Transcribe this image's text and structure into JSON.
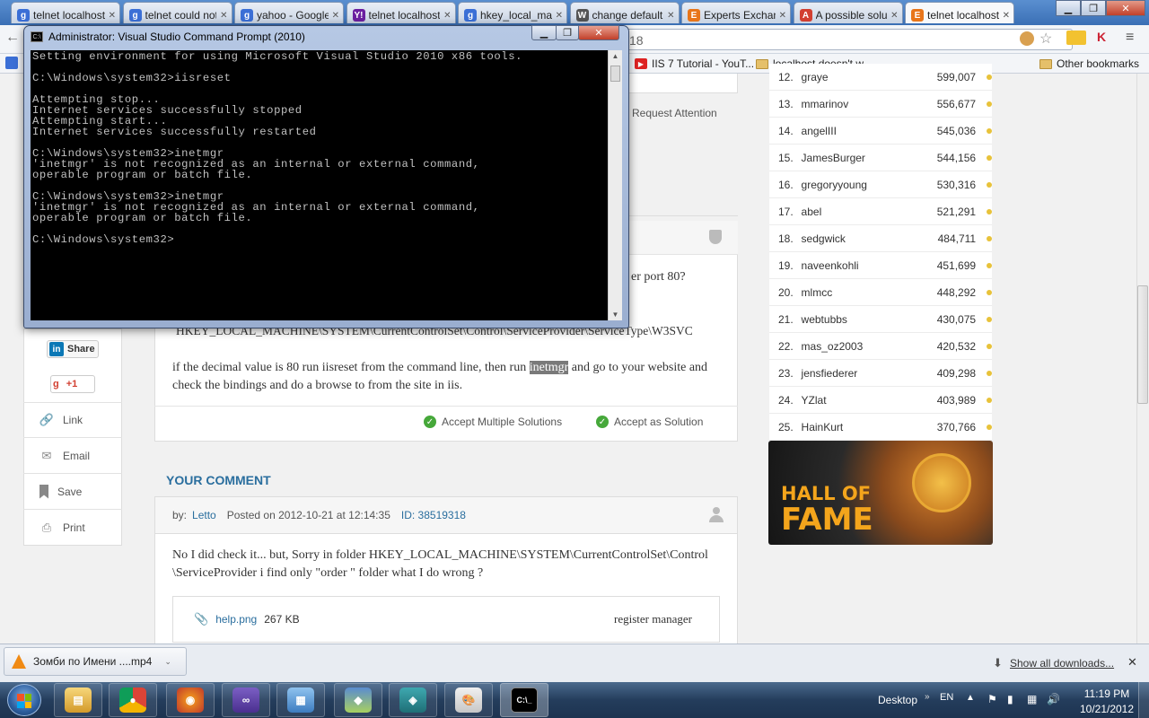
{
  "browser": {
    "tabs": [
      {
        "label": "telnet localhost",
        "icon": "google-icon",
        "color": "#3b6fd6"
      },
      {
        "label": "telnet could not",
        "icon": "google-icon",
        "color": "#3b6fd6"
      },
      {
        "label": "yahoo - Google",
        "icon": "google-icon",
        "color": "#3b6fd6"
      },
      {
        "label": "telnet localhost",
        "icon": "yahoo-icon",
        "color": "#6b1fa0"
      },
      {
        "label": "hkey_local_ma",
        "icon": "google-icon",
        "color": "#3b6fd6"
      },
      {
        "label": "change default",
        "icon": "wikipedia-icon",
        "color": "#555555"
      },
      {
        "label": "Experts Exchan",
        "icon": "ee-icon",
        "color": "#e8751a"
      },
      {
        "label": "A possible solu",
        "icon": "mail-icon",
        "color": "#d23f31"
      },
      {
        "label": "telnet localhost",
        "icon": "ee-icon",
        "color": "#e8751a",
        "active": true
      }
    ],
    "url_fragment": "18",
    "bookmarks": {
      "iis_tutorial": "IIS 7 Tutorial - YouT...",
      "localhost": "localhost doesn't w...",
      "other": "Other bookmarks"
    }
  },
  "cmd": {
    "title": "Administrator: Visual Studio Command Prompt (2010)",
    "output": "Setting environment for using Microsoft Visual Studio 2010 x86 tools.\n\nC:\\Windows\\system32>iisreset\n\nAttempting stop...\nInternet services successfully stopped\nAttempting start...\nInternet services successfully restarted\n\nC:\\Windows\\system32>inetmgr\n'inetmgr' is not recognized as an internal or external command,\noperable program or batch file.\n\nC:\\Windows\\system32>inetmgr\n'inetmgr' is not recognized as an internal or external command,\noperable program or batch file.\n\nC:\\Windows\\system32>"
  },
  "page": {
    "request_attention": "Request Attention",
    "port_fragment": "er port 80?",
    "registry_path": "HKEY_LOCAL_MACHINE\\SYSTEM\\CurrentControlSet\\Control\\ServiceProvider\\ServiceType\\W3SVC",
    "answer_before": "if the decimal value is 80 run iisreset from the command line, then run",
    "answer_highlight": "inetmgr",
    "answer_after": "and go to your website and check the bindings and do a browse to from the site in iis.",
    "accept_multiple": "Accept Multiple Solutions",
    "accept_solution": "Accept as Solution",
    "your_comment": "YOUR COMMENT",
    "comment_by": "by:",
    "comment_author": "Letto",
    "comment_posted": "Posted on 2012-10-21 at 12:14:35",
    "comment_id": "ID: 38519318",
    "comment_text": "No I did check it... but,  Sorry   in folder HKEY_LOCAL_MACHINE\\SYSTEM\\CurrentControlSet\\Control\\ServiceProvider i find only \"order \" folder what I do wrong ?",
    "attachment_name": "help.png",
    "attachment_size": "267 KB",
    "attachment_desc": "register manager"
  },
  "side_actions": {
    "share": "Share",
    "plus1": "+1",
    "link": "Link",
    "email": "Email",
    "save": "Save",
    "print": "Print"
  },
  "rankings": [
    {
      "rank": "12.",
      "name": "graye",
      "points": "599,007"
    },
    {
      "rank": "13.",
      "name": "mmarinov",
      "points": "556,677"
    },
    {
      "rank": "14.",
      "name": "angelIII",
      "points": "545,036"
    },
    {
      "rank": "15.",
      "name": "JamesBurger",
      "points": "544,156"
    },
    {
      "rank": "16.",
      "name": "gregoryyoung",
      "points": "530,316"
    },
    {
      "rank": "17.",
      "name": "abel",
      "points": "521,291"
    },
    {
      "rank": "18.",
      "name": "sedgwick",
      "points": "484,711"
    },
    {
      "rank": "19.",
      "name": "naveenkohli",
      "points": "451,699"
    },
    {
      "rank": "20.",
      "name": "mlmcc",
      "points": "448,292"
    },
    {
      "rank": "21.",
      "name": "webtubbs",
      "points": "430,075"
    },
    {
      "rank": "22.",
      "name": "mas_oz2003",
      "points": "420,532"
    },
    {
      "rank": "23.",
      "name": "jensfiederer",
      "points": "409,298"
    },
    {
      "rank": "24.",
      "name": "YZlat",
      "points": "403,989"
    },
    {
      "rank": "25.",
      "name": "HainKurt",
      "points": "370,766"
    }
  ],
  "hall_of_fame": {
    "line1": "HALL OF",
    "line2": "FAME"
  },
  "downloads": {
    "file": "Зомби по Имени ....mp4",
    "show_all": "Show all downloads..."
  },
  "taskbar": {
    "desktop": "Desktop",
    "lang": "EN",
    "time": "11:19 PM",
    "date": "10/21/2012"
  },
  "colors": {
    "accent": "#2a6e9e",
    "link": "#2a6e9e",
    "highlight_bg": "#7a7a7a"
  }
}
